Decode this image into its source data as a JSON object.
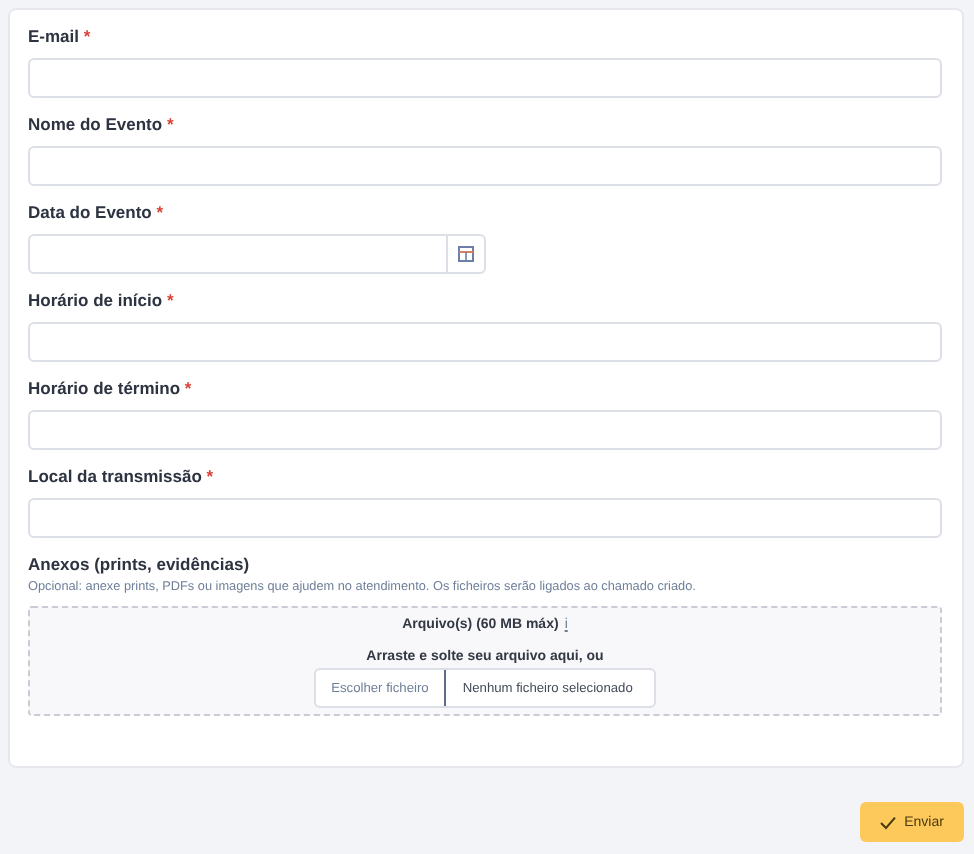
{
  "fields": [
    {
      "label": "E-mail",
      "mark": "*",
      "kind": "text"
    },
    {
      "label": "Nome do Evento",
      "mark": "*",
      "kind": "text"
    },
    {
      "label": "Data do Evento",
      "mark": "*",
      "kind": "date"
    },
    {
      "label": "Horário de início",
      "mark": "*",
      "kind": "text"
    },
    {
      "label": "Horário de término",
      "mark": "*",
      "kind": "text"
    },
    {
      "label": "Local da transmissão",
      "mark": "*",
      "kind": "text"
    }
  ],
  "attachments": {
    "label": "Anexos (prints, evidências)",
    "hint": "Opcional: anexe prints, PDFs ou imagens que ajudem no atendimento. Os ficheiros serão ligados ao chamado criado.",
    "dropzone_title": "Arquivo(s) (60 MB máx)",
    "info": "i",
    "drop_text": "Arraste e solte seu arquivo aqui, ou",
    "choose_button": "Escolher ficheiro",
    "file_status": "Nenhum ficheiro selecionado"
  },
  "submit": {
    "label": "Enviar"
  }
}
